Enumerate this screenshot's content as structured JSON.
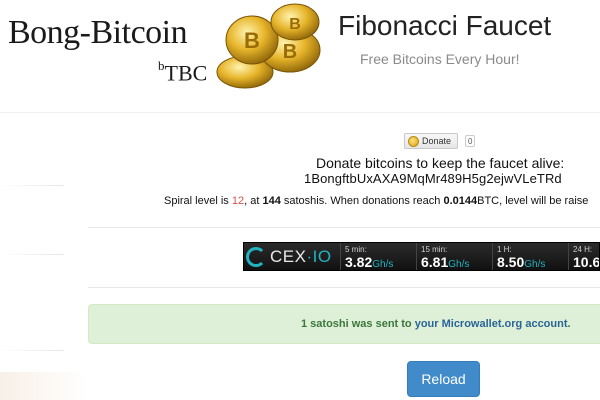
{
  "header": {
    "logo_title": "Bong-Bitcoin",
    "logo_sub_prefix": "b",
    "logo_sub": "TBC",
    "site_title": "Fibonacci Faucet",
    "tagline": "Free Bitcoins Every Hour!"
  },
  "donate": {
    "button_label": "Donate",
    "count": "0",
    "message": "Donate bitcoins to keep the faucet alive:",
    "address": "1BongftbUxAXA9MqMr489H5g2ejwVLeTRd"
  },
  "spiral": {
    "prefix": "Spiral level is ",
    "level": "12",
    "mid": ", at ",
    "satoshis": "144",
    "after_satoshis": " satoshis. When donations reach ",
    "target": "0.0144",
    "suffix": "BTC, level will be raise"
  },
  "ticker": {
    "brand_main": "CEX",
    "brand_accent": "·IO",
    "items": [
      {
        "label": "5 min:",
        "value": "3.82",
        "unit": "Gh/s"
      },
      {
        "label": "15 min:",
        "value": "6.81",
        "unit": "Gh/s"
      },
      {
        "label": "1 H:",
        "value": "8.50",
        "unit": "Gh/s"
      },
      {
        "label": "24 H:",
        "value": "10.6",
        "unit": ""
      }
    ]
  },
  "alert": {
    "prefix": "1 satoshi was sent to ",
    "link_text": "your Microwallet.org account",
    "suffix": "."
  },
  "actions": {
    "reload_label": "Reload"
  },
  "colors": {
    "alert_bg": "#dff0d8",
    "alert_text": "#3c763d",
    "button_primary": "#428bca",
    "ticker_accent": "#22b3c0",
    "spiral_level": "#d9534f"
  }
}
